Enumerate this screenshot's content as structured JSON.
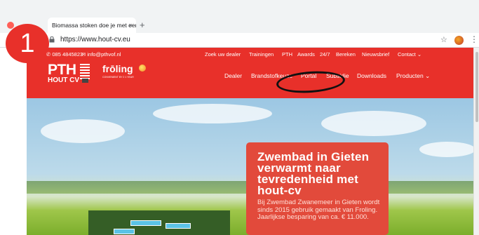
{
  "step_number": "1",
  "browser": {
    "tab_title": "Biomassa stoken doe je met een",
    "tab_close": "×",
    "new_tab": "+",
    "url": "https://www.hout-cv.eu",
    "star_icon": "☆",
    "menu_icon": "⋮"
  },
  "header": {
    "phone": "085 4845823",
    "email": "info@pthvof.nl",
    "top_nav": [
      "Zoek uw dealer",
      "Trainingen",
      "PTH",
      "Awards",
      "24/7",
      "Bereken",
      "Nieuwsbrief",
      "Contact ⌄"
    ],
    "logo": {
      "pth": "PTH",
      "hout_cv": "HOUT CV",
      "froling": "frōling",
      "tagline": "CONVENIENT BY 2 1 YEAR"
    },
    "main_nav": [
      "Dealer",
      "Brandstofkeuze",
      "Portal",
      "Subsidie",
      "Downloads",
      "Producten ⌄"
    ]
  },
  "hero": {
    "title": "Zwembad in Gieten verwarmt naar tevredenheid met hout-cv",
    "body": "Bij Zwembad Zwanemeer in Gieten wordt sinds 2015 gebruik gemaakt van Froling. Jaarlijkse besparing van ca. € 11.000."
  },
  "colors": {
    "brand_red": "#e8302a",
    "callout_red": "#e24a3b"
  },
  "annotation": {
    "circled_item": "Portal"
  }
}
